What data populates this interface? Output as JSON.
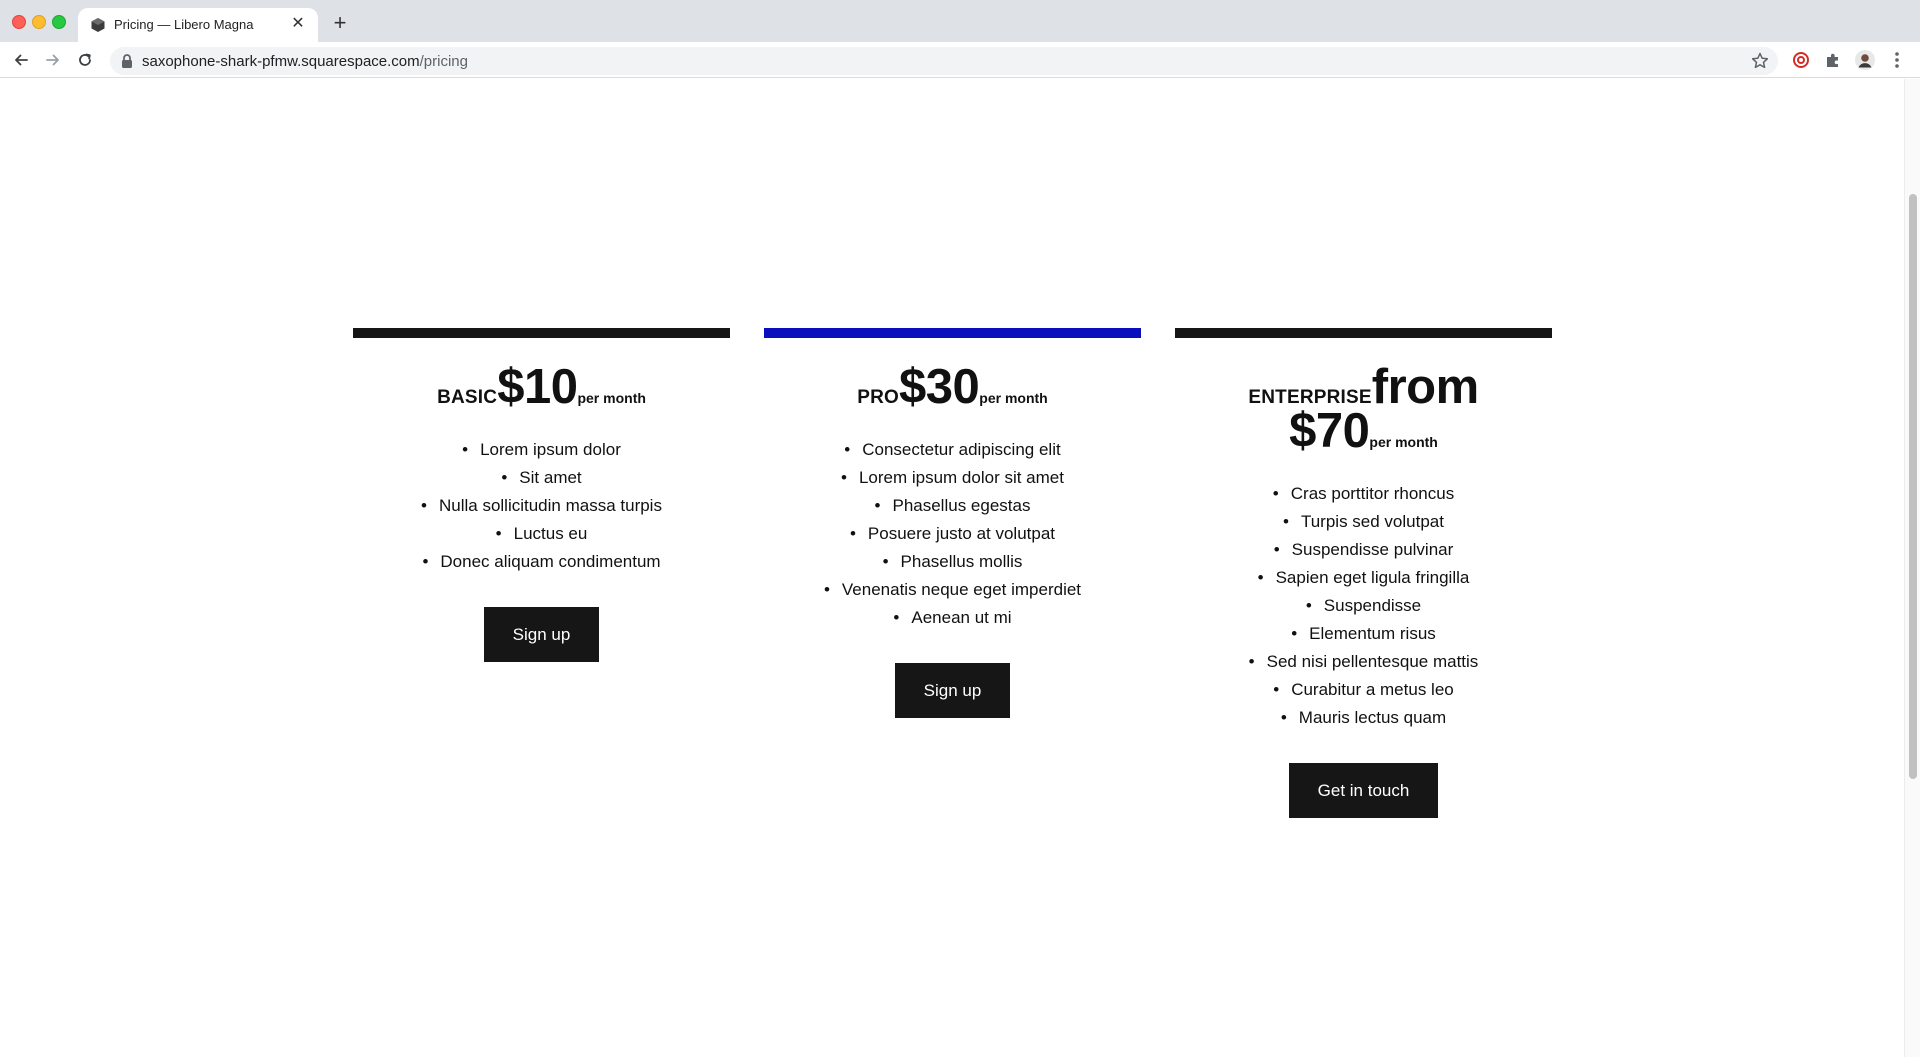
{
  "browser": {
    "tab_title": "Pricing — Libero Magna",
    "url_host": "saxophone-shark-pfmw.squarespace.com",
    "url_path": "/pricing"
  },
  "plans": [
    {
      "name": "BASIC",
      "price": "$10",
      "unit": "per month",
      "features": [
        "Lorem ipsum dolor",
        "Sit amet",
        "Nulla sollicitudin massa turpis",
        "Luctus eu",
        "Donec aliquam condimentum"
      ],
      "cta": "Sign up",
      "accent": "#161616"
    },
    {
      "name": "PRO",
      "price": "$30",
      "unit": "per month",
      "features": [
        "Consectetur adipiscing elit",
        "Lorem ipsum dolor sit amet",
        "Phasellus egestas",
        "Posuere justo at volutpat",
        "Phasellus mollis",
        "Venenatis neque eget imperdiet",
        "Aenean ut mi"
      ],
      "cta": "Sign up",
      "accent": "#0a0fbd"
    },
    {
      "name": "ENTERPRISE",
      "price": "from $70",
      "unit": "per month",
      "features": [
        "Cras porttitor rhoncus",
        "Turpis sed volutpat",
        "Suspendisse pulvinar",
        "Sapien eget ligula fringilla",
        "Suspendisse",
        "Elementum risus",
        "Sed nisi pellentesque mattis",
        "Curabitur a metus leo",
        "Mauris lectus quam"
      ],
      "cta": "Get in touch",
      "accent": "#161616"
    }
  ]
}
